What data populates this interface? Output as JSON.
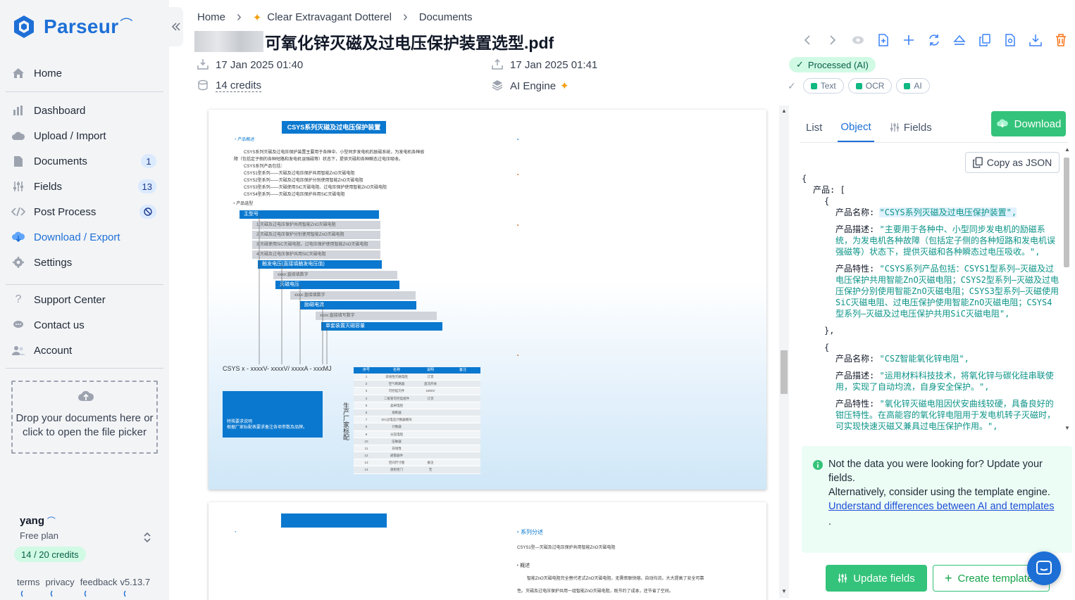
{
  "brand": {
    "name": "Parseur"
  },
  "nav": {
    "home": "Home",
    "dashboard": "Dashboard",
    "upload": "Upload / Import",
    "documents": "Documents",
    "documents_count": "1",
    "fields": "Fields",
    "fields_count": "13",
    "post_process": "Post Process",
    "download": "Download / Export",
    "settings": "Settings",
    "support": "Support Center",
    "contact": "Contact us",
    "account": "Account"
  },
  "dropzone": {
    "text": "Drop your documents here or click to open the file picker"
  },
  "user": {
    "name": "yang",
    "plan": "Free plan",
    "credits": "14 / 20 credits"
  },
  "footer": {
    "terms": "terms",
    "privacy": "privacy",
    "feedback": "feedback",
    "version": "v5.13.7"
  },
  "breadcrumb": {
    "home": "Home",
    "mailbox": "Clear Extravagant Dotterel",
    "documents": "Documents"
  },
  "document": {
    "title": "可氧化锌灭磁及过电压保护装置选型.pdf",
    "received": "17 Jan 2025 01:40",
    "processed_at": "17 Jan 2025 01:41",
    "credits": "14 credits",
    "engine": "AI Engine",
    "status": "Processed (AI)",
    "chips": [
      "Text",
      "OCR",
      "AI"
    ]
  },
  "colors": {
    "brand": "#1d6fd6",
    "green": "#34c37a",
    "json_string": "#0d9488"
  },
  "pdf_page1": {
    "title": "CSYS系列灭磁及过电压保护装置",
    "overview_heading": "产品概述",
    "overview_lines": [
      "CSYS系列灭磁及过电压保护装置主要用于各种中、小型同步发电机的励磁系统，为发电机各种故",
      "障（包括定子侧的各种短路和发电机误强磁等）状态下，提供灭磁和各种瞬态过电压吸收。",
      "CSYS系列产品包括：",
      "CSYS1型系列——灭磁及过电压保护共用智能ZnO灭磁电阻",
      "CSYS2型系列——灭磁及过电压保护分别使用智能ZnO灭磁电阻",
      "CSYS3型系列——灭磁使用SiC灭磁电阻、过电压保护使用智能ZnO灭磁电阻",
      "CSYS4型系列——灭磁及过电压保护共用SiC灭磁电阻"
    ],
    "selection_heading": "产品选型",
    "main_type": "主型号",
    "options": [
      "1:灭磁及过电压保护共用智能ZnO灭磁电阻",
      "2:灭磁及过电压保护分别使用智能ZnO灭磁电阻",
      "3:灭磁使用SiC灭磁电阻，过电压保护使用智能ZnO灭磁电阻",
      "4:灭磁及过电压保护共用SiC灭磁电阻"
    ],
    "trigger": "触发电压(直接填触发电压值)",
    "xxxx1": "xxxx:直接填数字",
    "demag": "灭磁电压",
    "xxxx2": "xxxx:直接填数字",
    "excite": "励磁电流",
    "xxxx3": "xxxx:直接填写数字",
    "capacity": "单套装置灭磁容量",
    "model": "CSYS x - xxxxV- xxxxV/ xxxxA - xxxMJ",
    "note": "特殊要求说明\n根据厂家标配表要求备注各项参数及品牌。",
    "vertical": "生产厂家标配",
    "table_headers": [
      "序号",
      "名称",
      "说明",
      "备注"
    ],
    "table_rows": [
      [
        "1",
        "非线性灭磁电阻",
        "订货"
      ],
      [
        "2",
        "空气断路器",
        "直流开关"
      ],
      [
        "3",
        "可控硅元件",
        "1800V"
      ],
      [
        "4",
        "二极管可控硅组件",
        "订货"
      ],
      [
        "5",
        "晶闸电阻",
        ""
      ],
      [
        "6",
        "熔断器",
        ""
      ],
      [
        "7",
        "SiC过电压计数器模块",
        ""
      ],
      [
        "8",
        "计数器",
        ""
      ],
      [
        "9",
        "分压电阻",
        ""
      ],
      [
        "10",
        "压敏器",
        ""
      ],
      [
        "11",
        "非线性",
        "",
        ""
      ],
      [
        "12",
        "避雷器件",
        ""
      ],
      [
        "13",
        "空间尺寸图",
        "备注"
      ],
      [
        "14",
        "盘柜柜门",
        "无"
      ]
    ]
  },
  "pdf_page2": {
    "heading": "系列分述",
    "sub": "CSYS1型—灭磁及过电压保护共用智能ZnO灭磁电阻",
    "overview": "概述",
    "line1": "智能ZnO灭磁电阻完全替代老式ZnO灭磁电阻，无需串联快熔，自动均流，大大提高了安全可靠",
    "line2": "性。灭磁及过电压保护共用一组智能ZnO灭磁电阻，既节约了成本，还节省了空间。"
  },
  "panel": {
    "tabs": [
      "List",
      "Object",
      "Fields"
    ],
    "download": "Download",
    "copy_json": "Copy as JSON",
    "json_root_key": "产品",
    "items": [
      {
        "name_key": "产品名称",
        "name": "\"CSYS系列灭磁及过电压保护装置\",",
        "desc_key": "产品描述",
        "desc": "\"主要用于各种中、小型同步发电机的励磁系统，为发电机各种故障（包括定子侧的各种短路和发电机误强磁等）状态下，提供灭磁和各种瞬态过电压吸收。\",",
        "feat_key": "产品特性",
        "feat": "\"CSYS系列产品包括：CSYS1型系列—灭磁及过电压保护共用智能ZnO灭磁电阻；CSYS2型系列—灭磁及过电压保护分别使用智能ZnO灭磁电阻；CSYS3型系列—灭磁使用SiC灭磁电阻、过电压保护使用智能ZnO灭磁电阻；CSYS4型系列—灭磁及过电压保护共用SiC灭磁电阻\","
      },
      {
        "name_key": "产品名称",
        "name": "\"CSZ智能氧化锌电阻\",",
        "desc_key": "产品描述",
        "desc": "\"运用材料科技技术，将氧化锌与碳化硅串联使用，实现了自动均流，自身安全保护。\",",
        "feat_key": "产品特性",
        "feat": "\"氧化锌灭磁电阻因伏安曲线较硬，具备良好的钳压特性。在高能容的氧化锌电阻用于发电机转子灭磁时，可实现快速灭磁又兼具过电压保护作用。\","
      }
    ],
    "info_line1": "Not the data you were looking for? Update your fields.",
    "info_line2": "Alternatively, consider using the template engine.",
    "info_link": "Understand differences between AI and templates",
    "info_dot": ".",
    "update_fields": "Update fields",
    "create_template": "Create template"
  }
}
